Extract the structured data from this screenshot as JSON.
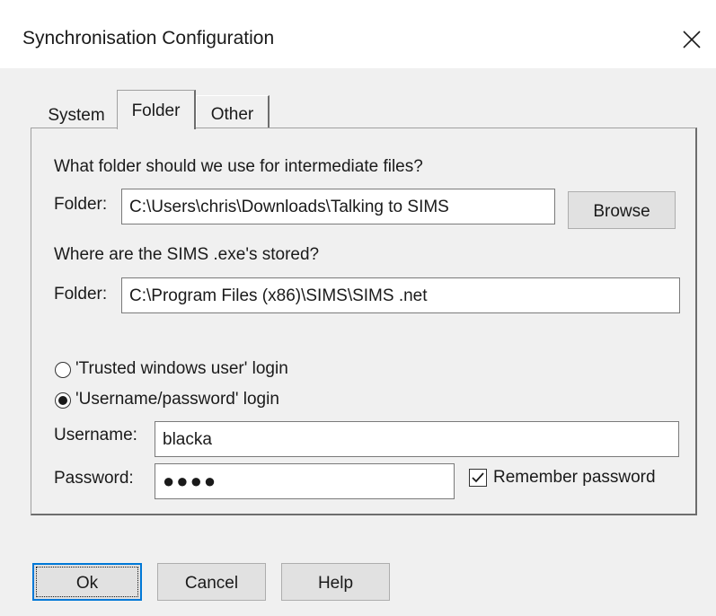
{
  "window": {
    "title": "Synchronisation Configuration",
    "close_glyph": "✕"
  },
  "tabs": [
    {
      "label": "System",
      "active": false
    },
    {
      "label": "Folder",
      "active": true
    },
    {
      "label": "Other",
      "active": false
    }
  ],
  "folder_tab": {
    "intermediate_question": "What folder should we use for intermediate files?",
    "intermediate_label": "Folder:",
    "intermediate_value": "C:\\Users\\chris\\Downloads\\Talking to SIMS",
    "browse_label": "Browse",
    "exe_question": "Where are the SIMS .exe's stored?",
    "exe_label": "Folder:",
    "exe_value": "C:\\Program Files (x86)\\SIMS\\SIMS .net",
    "login_options": [
      {
        "label": "'Trusted windows user' login",
        "selected": false
      },
      {
        "label": "'Username/password' login",
        "selected": true
      }
    ],
    "username_label": "Username:",
    "username_value": "blacka",
    "password_label": "Password:",
    "password_value": "●●●●",
    "remember_label": "Remember password",
    "remember_checked": true
  },
  "buttons": {
    "ok": "Ok",
    "cancel": "Cancel",
    "help": "Help"
  },
  "colors": {
    "window_bg": "#f0f0f0",
    "titlebar_bg": "#ffffff",
    "default_button_border": "#0078d7"
  }
}
